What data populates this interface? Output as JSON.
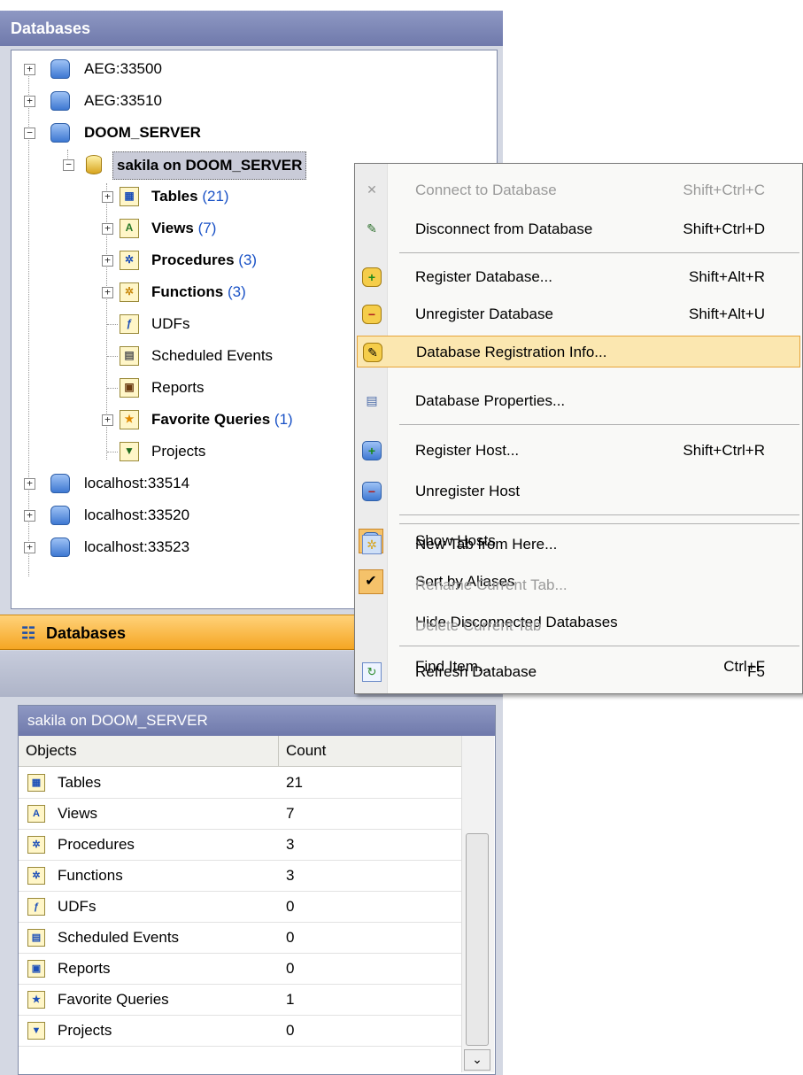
{
  "explorer": {
    "title": "Databases",
    "tree": {
      "hosts_top": [
        {
          "label": "AEG:33500"
        },
        {
          "label": "AEG:33510"
        },
        {
          "label": "DOOM_SERVER"
        }
      ],
      "database": {
        "label": "sakila on DOOM_SERVER"
      },
      "objects": [
        {
          "label": "Tables",
          "count": "(21)",
          "bold": true,
          "icon": "table-icon",
          "expand": true
        },
        {
          "label": "Views",
          "count": "(7)",
          "bold": true,
          "icon": "view-icon",
          "expand": true
        },
        {
          "label": "Procedures",
          "count": "(3)",
          "bold": true,
          "icon": "procedure-icon",
          "expand": true
        },
        {
          "label": "Functions",
          "count": "(3)",
          "bold": true,
          "icon": "function-icon",
          "expand": true
        },
        {
          "label": "UDFs",
          "count": "",
          "bold": false,
          "icon": "udf-icon",
          "expand": false
        },
        {
          "label": "Scheduled Events",
          "count": "",
          "bold": false,
          "icon": "event-icon",
          "expand": false
        },
        {
          "label": "Reports",
          "count": "",
          "bold": false,
          "icon": "report-icon",
          "expand": false
        },
        {
          "label": "Favorite Queries",
          "count": "(1)",
          "bold": true,
          "icon": "star-icon",
          "expand": true
        },
        {
          "label": "Projects",
          "count": "",
          "bold": false,
          "icon": "filter-icon",
          "expand": false
        }
      ],
      "hosts_bottom": [
        {
          "label": "localhost:33514"
        },
        {
          "label": "localhost:33520"
        },
        {
          "label": "localhost:33523"
        }
      ]
    },
    "nav_title": "Databases"
  },
  "info": {
    "title": "sakila on DOOM_SERVER",
    "columns": [
      "Objects",
      "Count"
    ],
    "rows": [
      {
        "object": "Tables",
        "count": "21"
      },
      {
        "object": "Views",
        "count": "7"
      },
      {
        "object": "Procedures",
        "count": "3"
      },
      {
        "object": "Functions",
        "count": "3"
      },
      {
        "object": "UDFs",
        "count": "0"
      },
      {
        "object": "Scheduled Events",
        "count": "0"
      },
      {
        "object": "Reports",
        "count": "0"
      },
      {
        "object": "Favorite Queries",
        "count": "1"
      },
      {
        "object": "Projects",
        "count": "0"
      }
    ]
  },
  "menu": {
    "items": [
      {
        "label": "Connect to Database",
        "key": "Shift+Ctrl+C",
        "disabled": true,
        "icon": "connect-icon"
      },
      {
        "label": "Disconnect from Database",
        "key": "Shift+Ctrl+D",
        "disabled": false,
        "icon": "disconnect-icon"
      },
      {
        "label": "Register Database...",
        "key": "Shift+Alt+R",
        "disabled": false,
        "icon": "register-database-icon"
      },
      {
        "label": "Unregister Database",
        "key": "Shift+Alt+U",
        "disabled": false,
        "icon": "unregister-database-icon"
      },
      {
        "label": "Database Registration Info...",
        "key": "",
        "disabled": false,
        "icon": "registration-info-icon"
      },
      {
        "label": "Database Properties...",
        "key": "",
        "disabled": false,
        "icon": "properties-icon"
      },
      {
        "label": "Register Host...",
        "key": "Shift+Ctrl+R",
        "disabled": false,
        "icon": "register-host-icon"
      },
      {
        "label": "Unregister Host",
        "key": "",
        "disabled": false,
        "icon": "unregister-host-icon"
      },
      {
        "label_pre": "Show ",
        "label_u": "H",
        "label_post": "osts",
        "key": "",
        "disabled": false,
        "icon": "show-hosts-icon"
      },
      {
        "label": "Sort by Aliases",
        "key": "",
        "disabled": false,
        "icon": "check-icon"
      },
      {
        "label": "Hide Disconnected Databases",
        "key": "",
        "disabled": false,
        "icon": ""
      },
      {
        "label": "Refresh Database",
        "key": "F5",
        "disabled": false,
        "icon": "refresh-icon"
      },
      {
        "label": "New Tab from Here...",
        "key": "",
        "disabled": false,
        "icon": "new-tab-icon"
      },
      {
        "label": "Rename Current Tab...",
        "key": "",
        "disabled": true,
        "icon": ""
      },
      {
        "label": "Delete Current Tab",
        "key": "",
        "disabled": true,
        "icon": ""
      },
      {
        "label": "Find Item...",
        "key": "Ctrl+F",
        "disabled": false,
        "icon": ""
      }
    ]
  }
}
